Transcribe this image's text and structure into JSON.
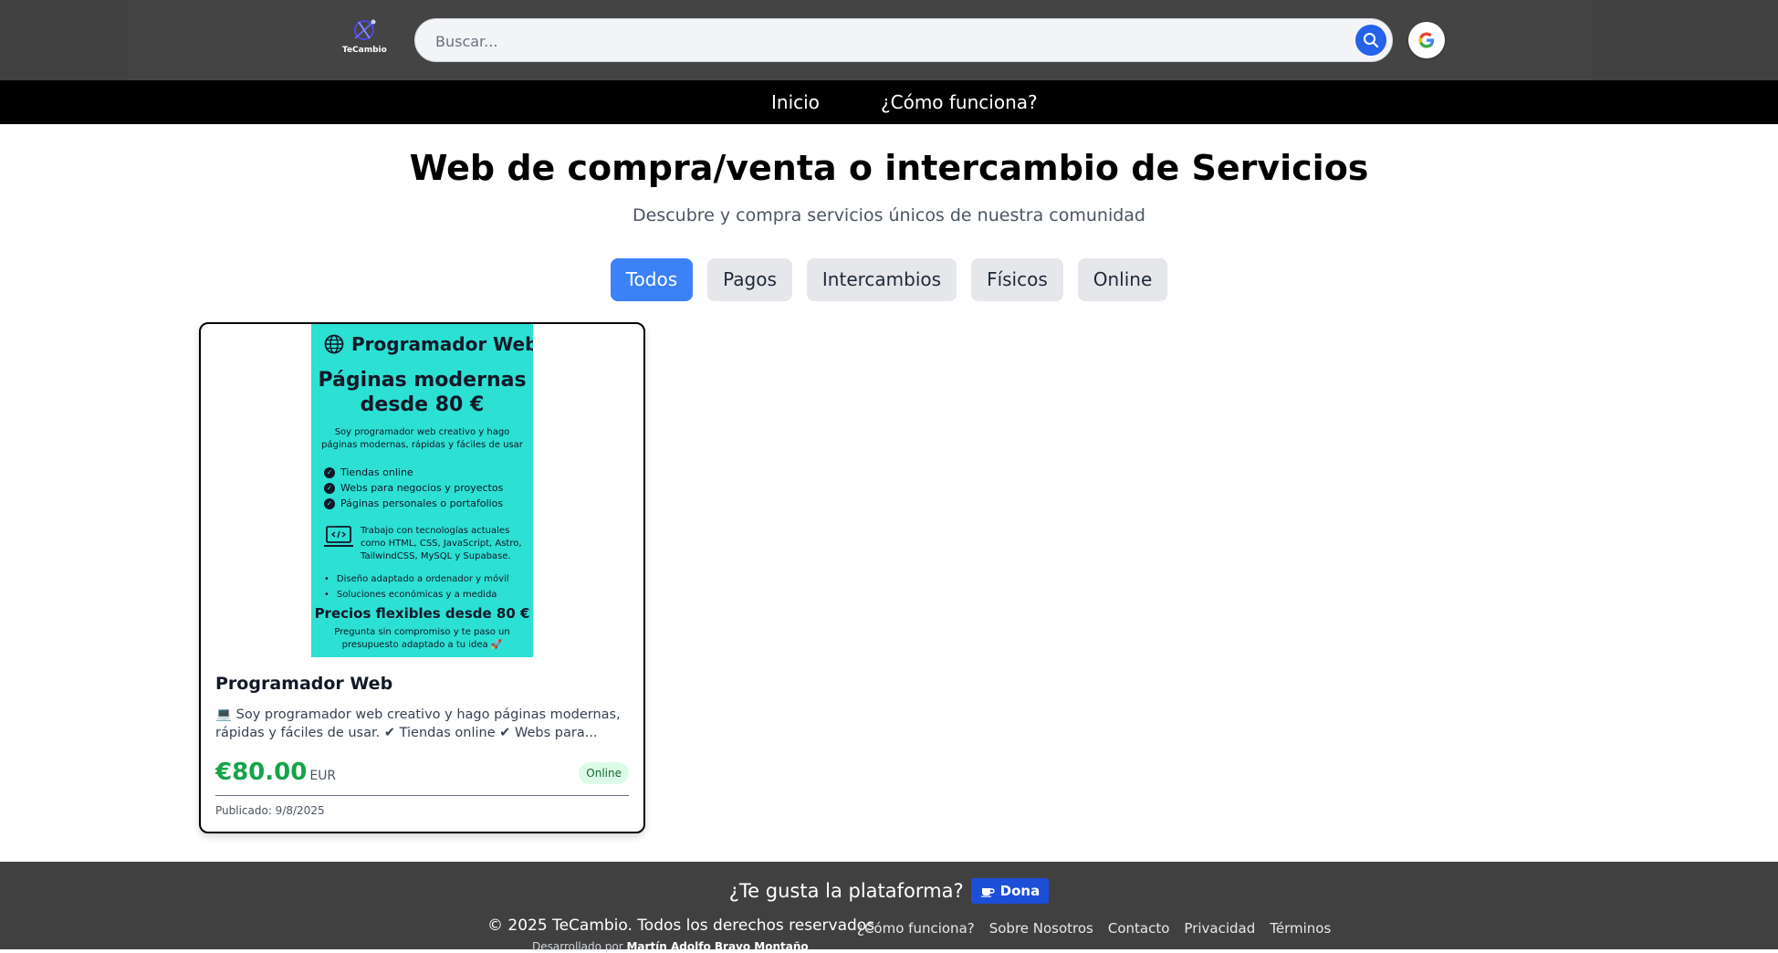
{
  "header": {
    "logo_text": "TeCambio",
    "search_placeholder": "Buscar...",
    "search_icon": "search-icon",
    "google_icon": "google-icon"
  },
  "nav": {
    "items": [
      {
        "label": "Inicio"
      },
      {
        "label": "¿Cómo funciona?"
      }
    ]
  },
  "hero": {
    "title": "Web de compra/venta o intercambio de Servicios",
    "subtitle": "Descubre y compra servicios únicos de nuestra comunidad"
  },
  "filters": {
    "items": [
      {
        "label": "Todos",
        "active": true
      },
      {
        "label": "Pagos"
      },
      {
        "label": "Intercambios"
      },
      {
        "label": "Físicos"
      },
      {
        "label": "Online"
      }
    ],
    "active_color": "#3b82f6"
  },
  "listing": {
    "image": {
      "heading": "Programador Web",
      "headline_1": "Páginas modernas",
      "headline_2": "desde 80 €",
      "intro_1": "Soy programador web creativo y hago",
      "intro_2": "páginas modernas, rápidas y fáciles de usar",
      "checks": [
        "Tiendas online",
        "Webs para negocios y proyectos",
        "Páginas personales o portafolios"
      ],
      "tech_1": "Trabajo con tecnologías actuales",
      "tech_2": "como HTML, CSS, JavaScript, Astro,",
      "tech_3": "TailwindCSS, MySQL y Supabase.",
      "bullets": [
        "Diseño adaptado a ordenador y móvil",
        "Soluciones económicas y a medida"
      ],
      "prices": "Precios flexibles desde 80 €",
      "cta_1": "Pregunta sin compromiso y te paso un",
      "cta_2": "presupuesto adaptado a tu idea 🚀",
      "bg_color": "#2ce0d3"
    },
    "title": "Programador Web",
    "description": "💻 Soy programador web creativo y hago páginas modernas, rápidas y fáciles de usar. ✔ Tiendas online ✔ Webs para...",
    "price": "€80.00",
    "currency": "EUR",
    "badge": "Online",
    "published": "Publicado: 9/8/2025"
  },
  "footer": {
    "question": "¿Te gusta la plataforma?",
    "donate_label": "Dona",
    "copyright": "© 2025 TeCambio. Todos los derechos reservados",
    "developed_prefix": "Desarrollado por",
    "developer": "Martín Adolfo Bravo Montaño",
    "links": [
      {
        "label": "¿Cómo funciona?"
      },
      {
        "label": "Sobre Nosotros"
      },
      {
        "label": "Contacto"
      },
      {
        "label": "Privacidad"
      },
      {
        "label": "Términos"
      }
    ]
  }
}
